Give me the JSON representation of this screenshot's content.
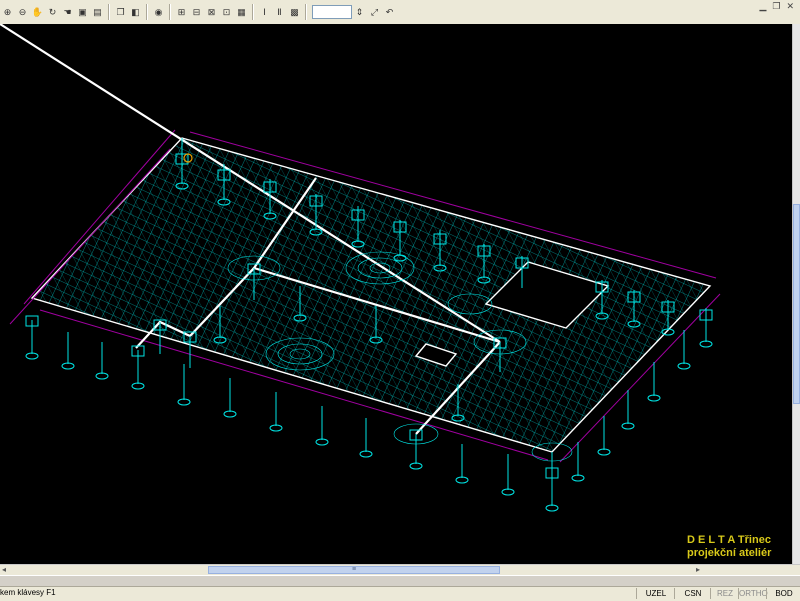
{
  "toolbar": {
    "zoom_value": "",
    "window_controls": [
      "minimize",
      "maximize",
      "close"
    ]
  },
  "watermark": {
    "line1": "D E L T A  Třinec",
    "line2": "projekční ateliér"
  },
  "status": {
    "hint": "kem klávesy F1",
    "cells": [
      {
        "label": "UZEL",
        "active": true
      },
      {
        "label": "CSN",
        "active": true
      },
      {
        "label": "REZ",
        "active": false
      },
      {
        "label": "ORTHO",
        "active": false
      },
      {
        "label": "BOD",
        "active": true
      }
    ]
  },
  "colors": {
    "canvas": "#000000",
    "mesh": "#00e5e5",
    "edge": "#ffffff",
    "dimension": "#a000a0",
    "watermark": "#d8c91a"
  }
}
